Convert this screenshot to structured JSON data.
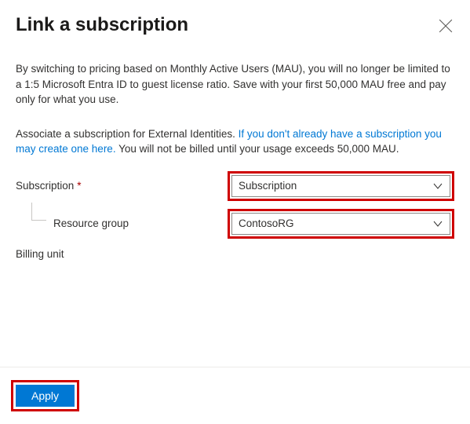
{
  "header": {
    "title": "Link a subscription"
  },
  "intro": "By switching to pricing based on Monthly Active Users (MAU), you will no longer be limited to a 1:5 Microsoft Entra ID to guest license ratio. Save with your first 50,000 MAU free and pay only for what you use.",
  "associate": {
    "prefix": "Associate a subscription for External Identities. ",
    "link": "If you don't already have a subscription you may create one here.",
    "suffix": " You will not be billed until your usage exceeds 50,000 MAU."
  },
  "form": {
    "subscription_label": "Subscription",
    "subscription_value": "Subscription",
    "resource_group_label": "Resource group",
    "resource_group_value": "ContosoRG",
    "billing_unit_label": "Billing unit"
  },
  "actions": {
    "apply": "Apply"
  },
  "highlight_color": "#cf0000"
}
